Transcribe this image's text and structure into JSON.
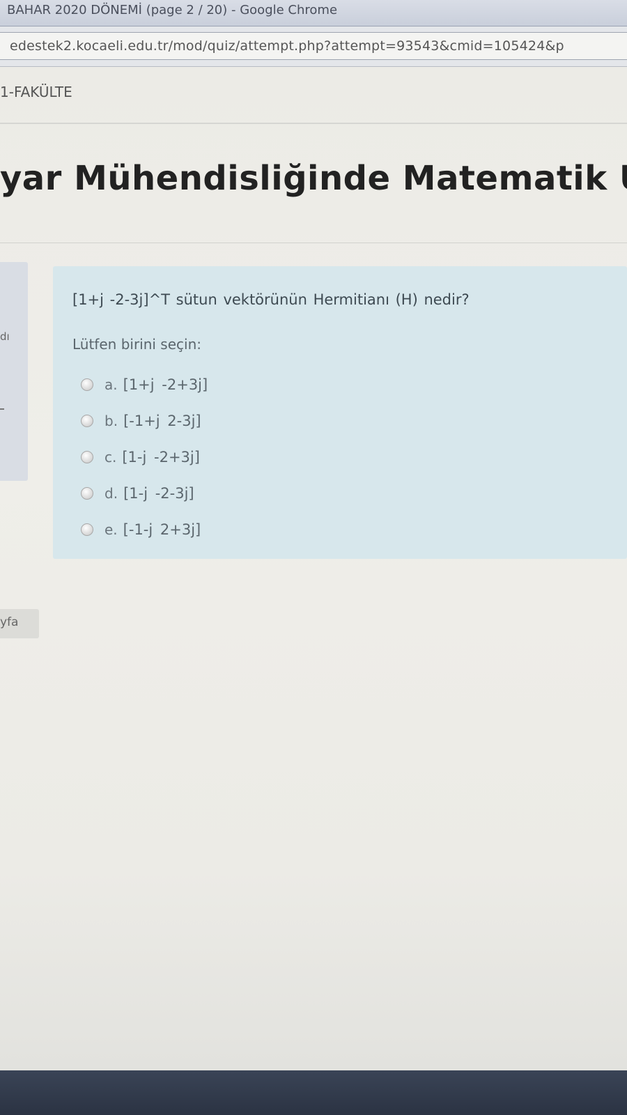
{
  "browser": {
    "window_title": "BAHAR 2020 DÖNEMİ (page 2 / 20) - Google Chrome",
    "url": "edestek2.kocaeli.edu.tr/mod/quiz/attempt.php?attempt=93543&cmid=105424&p"
  },
  "page": {
    "breadcrumb": "1-FAKÜLTE",
    "course_title": "yar Mühendisliğinde Matematik U",
    "info_label": "dı",
    "page_button": "yfa"
  },
  "question": {
    "text": "[1+j  -2-3j]^T  sütun vektörünün Hermitianı (H) nedir?",
    "prompt": "Lütfen birini seçin:",
    "options": [
      {
        "letter": "a.",
        "text": "[1+j  -2+3j]"
      },
      {
        "letter": "b.",
        "text": "[-1+j  2-3j]"
      },
      {
        "letter": "c.",
        "text": "[1-j  -2+3j]"
      },
      {
        "letter": "d.",
        "text": "[1-j  -2-3j]"
      },
      {
        "letter": "e.",
        "text": "[-1-j  2+3j]"
      }
    ]
  }
}
